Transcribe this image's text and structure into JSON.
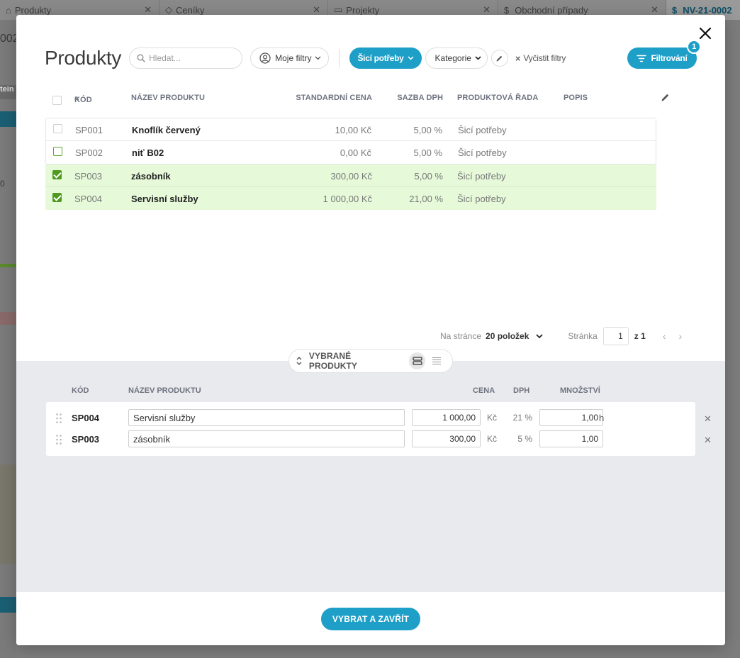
{
  "background": {
    "tabs": [
      {
        "label": "Produkty",
        "icon": "home-icon"
      },
      {
        "label": "Ceníky",
        "icon": "tag-icon"
      },
      {
        "label": "Projekty",
        "icon": "folder-icon"
      },
      {
        "label": "Obchodní případy",
        "icon": "dollar-icon"
      },
      {
        "label": "NV-21-0002",
        "icon": "dollar-icon"
      }
    ],
    "left_fragments": [
      "002",
      "tein",
      "0"
    ]
  },
  "modal": {
    "title": "Produkty",
    "search_placeholder": "Hledat...",
    "my_filters": "Moje filtry",
    "active_filter": "Šicí potřeby",
    "category_filter": "Kategorie",
    "clear_filters": "Vyčistit filtry",
    "filter_button": "Filtrování",
    "filter_count": "1"
  },
  "table": {
    "columns": {
      "code": "KÓD",
      "sort_indicator": "^",
      "name": "NÁZEV PRODUKTU",
      "price": "STANDARDNÍ CENA",
      "vat": "SAZBA DPH",
      "line": "PRODUKTOVÁ ŘADA",
      "desc": "POPIS"
    },
    "rows": [
      {
        "code": "SP001",
        "name": "Knoflík červený",
        "price": "10,00 Kč",
        "vat": "5,00 %",
        "line": "Šicí potřeby",
        "desc": "",
        "checked": false
      },
      {
        "code": "SP002",
        "name": "niť B02",
        "price": "0,00 Kč",
        "vat": "5,00 %",
        "line": "Šicí potřeby",
        "desc": "",
        "checked": false
      },
      {
        "code": "SP003",
        "name": "zásobník",
        "price": "300,00 Kč",
        "vat": "5,00 %",
        "line": "Šicí potřeby",
        "desc": "",
        "checked": true
      },
      {
        "code": "SP004",
        "name": "Servisní služby",
        "price": "1 000,00 Kč",
        "vat": "21,00 %",
        "line": "Šicí potřeby",
        "desc": "",
        "checked": true
      }
    ]
  },
  "pager": {
    "per_page_label": "Na stránce",
    "per_page_value": "20 položek",
    "page_label": "Stránka",
    "page_value": "1",
    "of_label": "z 1",
    "prev": "‹",
    "next": "›"
  },
  "selected": {
    "toggle_label": "VYBRANÉ PRODUKTY",
    "columns": {
      "code": "KÓD",
      "name": "NÁZEV PRODUKTU",
      "price": "CENA",
      "vat": "DPH",
      "qty": "MNOŽSTVÍ"
    },
    "items": [
      {
        "code": "SP004",
        "name": "Servisní služby",
        "price": "1 000,00",
        "currency": "Kč",
        "vat": "21 %",
        "qty": "1,00",
        "unit": "h"
      },
      {
        "code": "SP003",
        "name": "zásobník",
        "price": "300,00",
        "currency": "Kč",
        "vat": "5 %",
        "qty": "1,00",
        "unit": ""
      }
    ]
  },
  "footer": {
    "confirm_button": "VYBRAT A ZAVŘÍT"
  },
  "colors": {
    "accent": "#1e9fc8",
    "selected_row": "#e6fad9",
    "checkbox_green": "#4f9a1f"
  }
}
